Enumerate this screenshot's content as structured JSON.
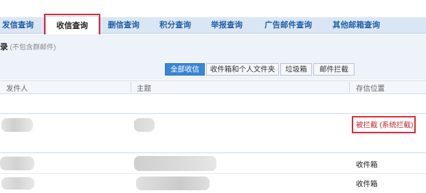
{
  "tabs": [
    {
      "label": "发信查询"
    },
    {
      "label": "收信查询"
    },
    {
      "label": "删信查询"
    },
    {
      "label": "积分查询"
    },
    {
      "label": "举报查询"
    },
    {
      "label": "广告邮件查询"
    },
    {
      "label": "其他邮箱查询"
    }
  ],
  "active_tab": "收信查询",
  "section": {
    "title": "录",
    "note": "(不包含群邮件)"
  },
  "filters": [
    {
      "label": "全部收信",
      "selected": true
    },
    {
      "label": "收件箱和个人文件夹",
      "selected": false
    },
    {
      "label": "垃圾箱",
      "selected": false
    },
    {
      "label": "邮件拦截",
      "selected": false
    }
  ],
  "columns": {
    "sender": "发件人",
    "subject": "主题",
    "location": "存信位置"
  },
  "rows": [
    {
      "sender": "",
      "subject": "",
      "location": "被拦截 (系统拦截)",
      "status": "intercepted"
    },
    {
      "sender": "",
      "subject": "",
      "location": "收件箱",
      "status": "normal"
    },
    {
      "sender": "",
      "subject": "",
      "location": "收件箱",
      "status": "normal"
    }
  ],
  "colors": {
    "tab_text": "#1e5fa8",
    "tab_bar": "#dbe6f5",
    "selected_filter": "#3a86d4",
    "intercept_text": "#c0242c",
    "highlight_outline": "#e0242f"
  }
}
